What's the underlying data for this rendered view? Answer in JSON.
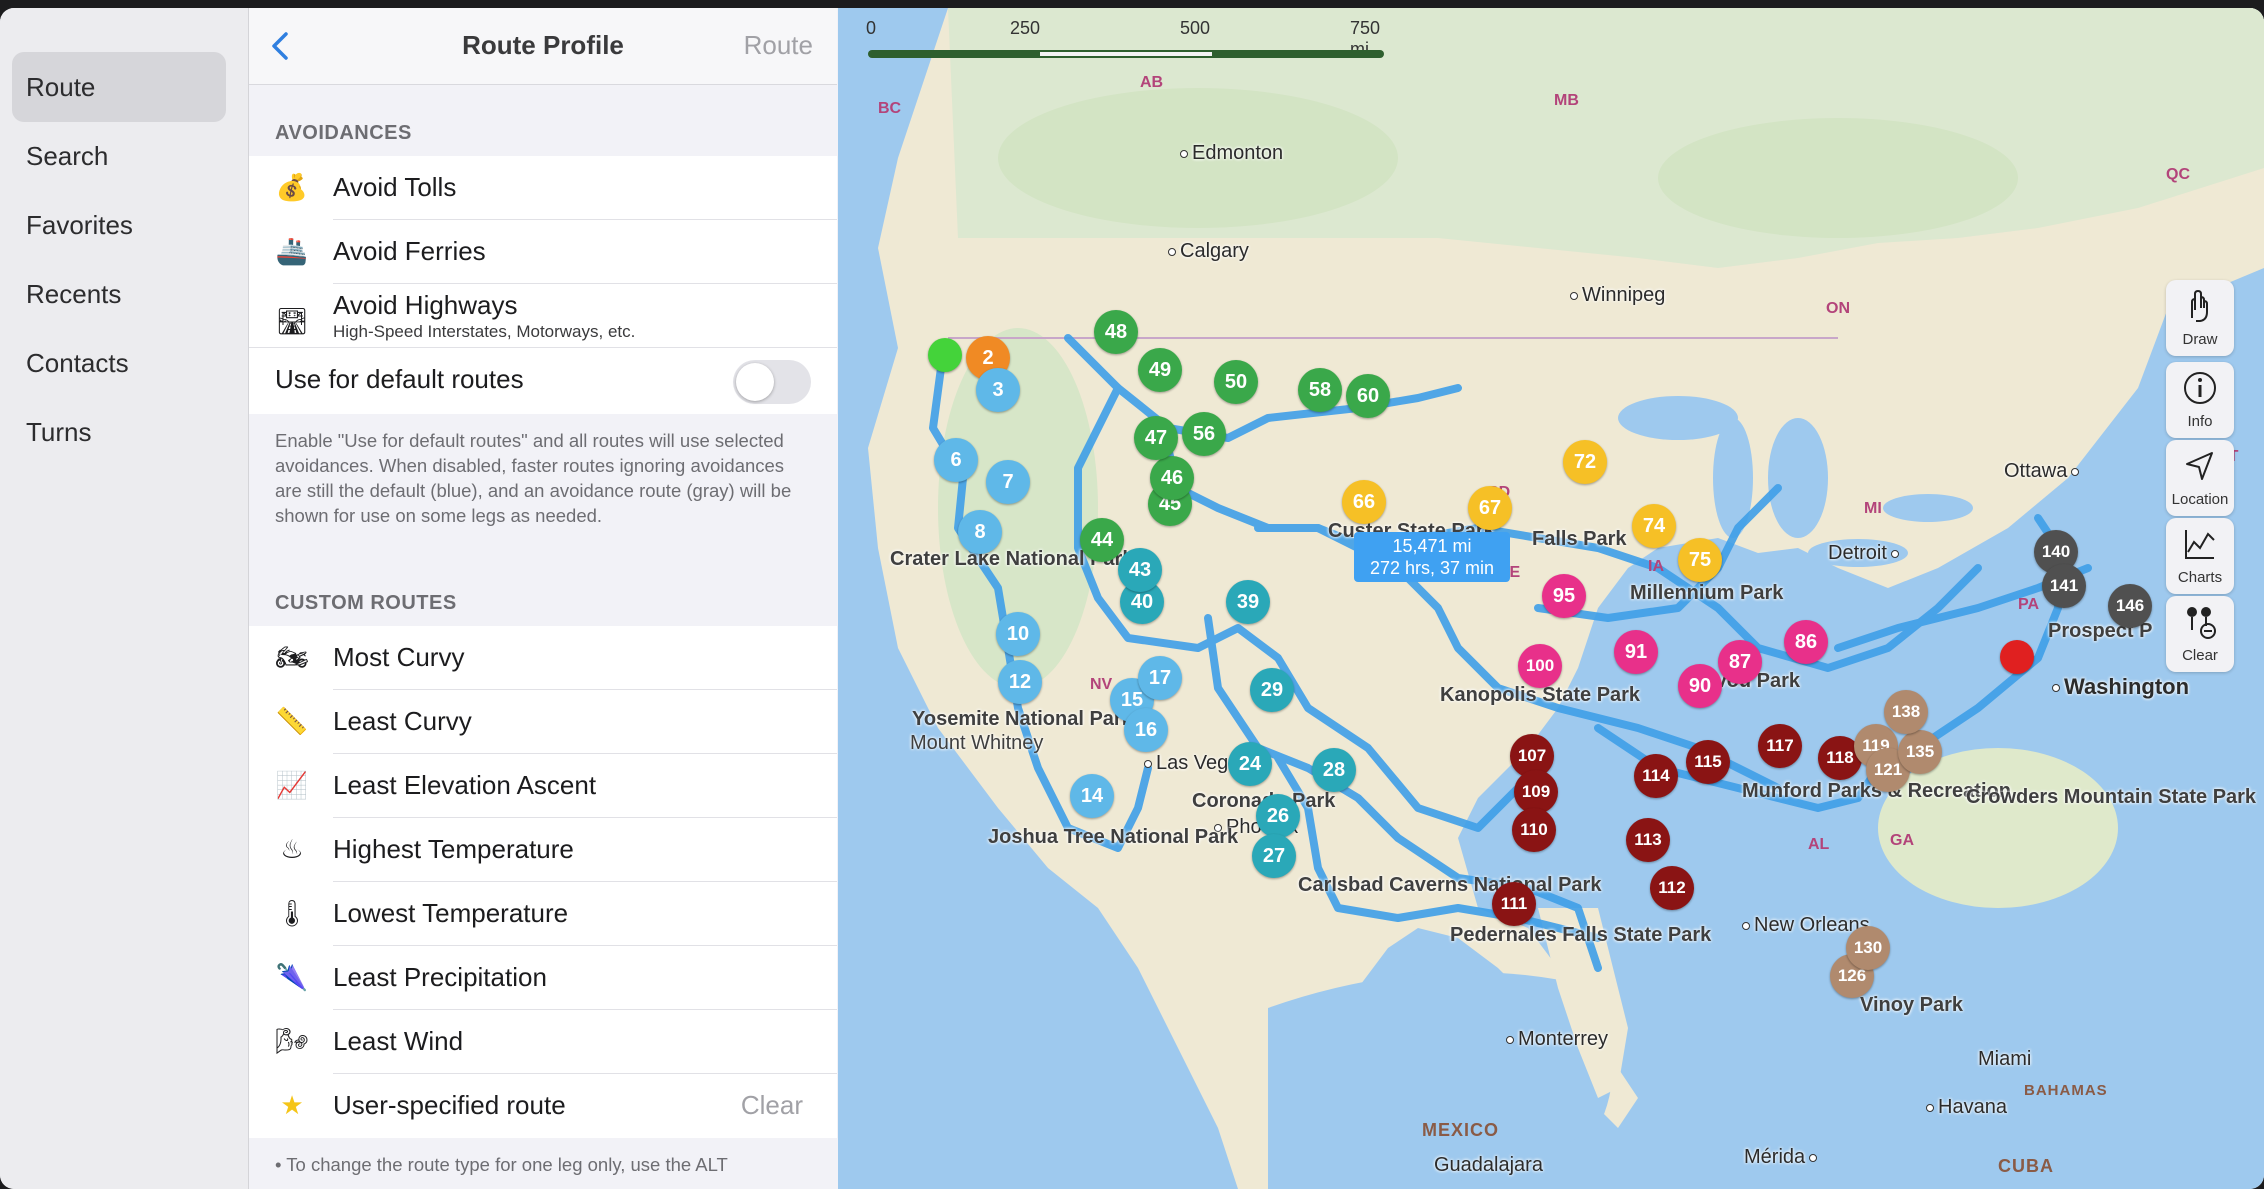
{
  "sidebar": {
    "items": [
      "Route",
      "Search",
      "Favorites",
      "Recents",
      "Contacts",
      "Turns"
    ]
  },
  "nav": {
    "title": "Route Profile",
    "right": "Route"
  },
  "avoidances": {
    "header": "AVOIDANCES",
    "tolls": "Avoid Tolls",
    "ferries": "Avoid Ferries",
    "highways": "Avoid Highways",
    "highways_sub": "High-Speed Interstates, Motorways, etc.",
    "default_routes": "Use for default routes",
    "default_routes_on": false,
    "footnote": "Enable \"Use for default routes\" and all routes will use selected avoidances. When disabled, faster routes ignoring avoidances are still the default (blue), and an avoidance route (gray) will be shown for use on some legs as needed."
  },
  "custom_routes": {
    "header": "CUSTOM ROUTES",
    "items": [
      "Most Curvy",
      "Least Curvy",
      "Least Elevation Ascent",
      "Highest Temperature",
      "Lowest Temperature",
      "Least Precipitation",
      "Least Wind",
      "User-specified route"
    ],
    "clear": "Clear",
    "footnote": "• To change the route type for one leg only, use the ALT"
  },
  "map": {
    "scale": [
      "0",
      "250",
      "500",
      "750 mi"
    ],
    "route_summary": [
      "15,471 mi",
      "272 hrs, 37 min"
    ],
    "tools": [
      "Draw",
      "Info",
      "Location",
      "Charts",
      "Clear"
    ],
    "cities": [
      "Edmonton",
      "Calgary",
      "Winnipeg",
      "Ottawa",
      "Detroit",
      "Washington",
      "Las Vegas",
      "Phoenix",
      "New Orleans",
      "Monterrey",
      "Miami",
      "Havana",
      "Guadalajara",
      "Mérida"
    ],
    "parks": [
      "Crater Lake National Park",
      "Yosemite National Park",
      "Mount Whitney",
      "Joshua Tree National Park",
      "Coronado Park",
      "Carlsbad Caverns National Park",
      "Custer State Park",
      "Falls Park",
      "Millennium Park",
      "Kanopolis State Park",
      "Devou Park",
      "Munford Parks & Recreation",
      "Crowders Mountain State Park",
      "Pedernales Falls State Park",
      "Vinoy Park",
      "Prospect P"
    ],
    "regions": [
      "BC",
      "AB",
      "MB",
      "ON",
      "QC",
      "SD",
      "IA",
      "MI",
      "NV",
      "AL",
      "GA",
      "PA",
      "VT",
      "NE"
    ],
    "countries": [
      "MEXICO",
      "CUBA",
      "BAHAMAS"
    ],
    "colors": {
      "green": "#3aa84a",
      "teal": "#2aa8b8",
      "lightblue": "#5fb8e8",
      "yellow": "#f6c026",
      "magenta": "#e8308a",
      "darkred": "#8a1414",
      "tan": "#b08a6e",
      "gray": "#505050",
      "red": "#e02020",
      "route": "#3f9fe8"
    }
  },
  "pins": [
    {
      "t": "2",
      "c": "#f08a24"
    },
    {
      "t": "3",
      "c": "#5fb8e8"
    },
    {
      "t": "6",
      "c": "#5fb8e8"
    },
    {
      "t": "7",
      "c": "#5fb8e8"
    },
    {
      "t": "8",
      "c": "#5fb8e8"
    },
    {
      "t": "10",
      "c": "#5fb8e8"
    },
    {
      "t": "12",
      "c": "#5fb8e8"
    },
    {
      "t": "14",
      "c": "#5fb8e8"
    },
    {
      "t": "15",
      "c": "#5fb8e8"
    },
    {
      "t": "16",
      "c": "#5fb8e8"
    },
    {
      "t": "17",
      "c": "#5fb8e8"
    },
    {
      "t": "24",
      "c": "#2aa8b8"
    },
    {
      "t": "26",
      "c": "#2aa8b8"
    },
    {
      "t": "27",
      "c": "#2aa8b8"
    },
    {
      "t": "28",
      "c": "#2aa8b8"
    },
    {
      "t": "29",
      "c": "#2aa8b8"
    },
    {
      "t": "39",
      "c": "#2aa8b8"
    },
    {
      "t": "40",
      "c": "#2aa8b8"
    },
    {
      "t": "43",
      "c": "#2aa8b8"
    },
    {
      "t": "44",
      "c": "#3aa84a"
    },
    {
      "t": "45",
      "c": "#3aa84a"
    },
    {
      "t": "46",
      "c": "#3aa84a"
    },
    {
      "t": "47",
      "c": "#3aa84a"
    },
    {
      "t": "48",
      "c": "#3aa84a"
    },
    {
      "t": "49",
      "c": "#3aa84a"
    },
    {
      "t": "50",
      "c": "#3aa84a"
    },
    {
      "t": "56",
      "c": "#3aa84a"
    },
    {
      "t": "58",
      "c": "#3aa84a"
    },
    {
      "t": "60",
      "c": "#3aa84a"
    },
    {
      "t": "66",
      "c": "#f6c026"
    },
    {
      "t": "67",
      "c": "#f6c026"
    },
    {
      "t": "72",
      "c": "#f6c026"
    },
    {
      "t": "74",
      "c": "#f6c026"
    },
    {
      "t": "75",
      "c": "#f6c026"
    },
    {
      "t": "86",
      "c": "#e8308a"
    },
    {
      "t": "87",
      "c": "#e8308a"
    },
    {
      "t": "90",
      "c": "#e8308a"
    },
    {
      "t": "91",
      "c": "#e8308a"
    },
    {
      "t": "95",
      "c": "#e8308a"
    },
    {
      "t": "100",
      "c": "#e8308a"
    },
    {
      "t": "107",
      "c": "#8a1414"
    },
    {
      "t": "109",
      "c": "#8a1414"
    },
    {
      "t": "110",
      "c": "#8a1414"
    },
    {
      "t": "111",
      "c": "#8a1414"
    },
    {
      "t": "112",
      "c": "#8a1414"
    },
    {
      "t": "113",
      "c": "#8a1414"
    },
    {
      "t": "114",
      "c": "#8a1414"
    },
    {
      "t": "115",
      "c": "#8a1414"
    },
    {
      "t": "117",
      "c": "#8a1414"
    },
    {
      "t": "118",
      "c": "#8a1414"
    },
    {
      "t": "119",
      "c": "#b08a6e"
    },
    {
      "t": "121",
      "c": "#b08a6e"
    },
    {
      "t": "126",
      "c": "#b08a6e"
    },
    {
      "t": "130",
      "c": "#b08a6e"
    },
    {
      "t": "135",
      "c": "#b08a6e"
    },
    {
      "t": "138",
      "c": "#b08a6e"
    },
    {
      "t": "140",
      "c": "#505050"
    },
    {
      "t": "141",
      "c": "#505050"
    },
    {
      "t": "146",
      "c": "#505050"
    }
  ]
}
